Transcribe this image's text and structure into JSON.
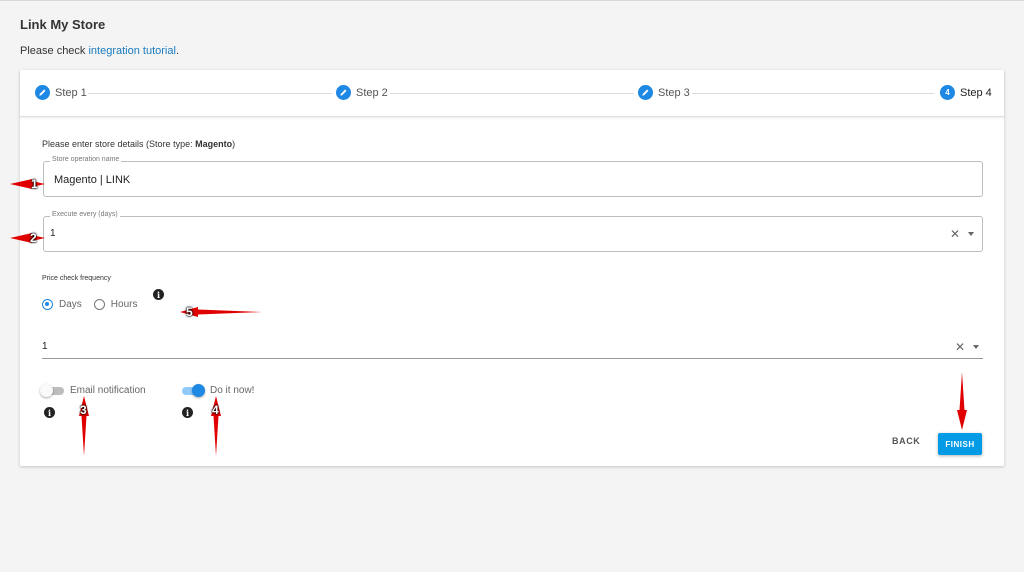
{
  "page": {
    "title": "Link My Store",
    "subtitle_prefix": "Please check ",
    "subtitle_link": "integration tutorial",
    "subtitle_suffix": "."
  },
  "stepper": {
    "steps": [
      {
        "label": "Step 1",
        "icon": "pencil-icon"
      },
      {
        "label": "Step 2",
        "icon": "pencil-icon"
      },
      {
        "label": "Step 3",
        "icon": "pencil-icon"
      },
      {
        "label": "Step 4",
        "number": "4"
      }
    ]
  },
  "form": {
    "heading_prefix": "Please enter store details (Store type: ",
    "store_type": "Magento",
    "heading_suffix": ")",
    "store_name": {
      "label": "Store operation name",
      "value": "Magento | LINK"
    },
    "execute_every": {
      "label": "Execute every (days)",
      "value": "1",
      "clear_icon": "close-icon"
    },
    "price_check": {
      "label": "Price check frequency",
      "options": [
        "Days",
        "Hours"
      ],
      "selected": "Days",
      "info_icon": "info-icon",
      "value": "1"
    },
    "email_notification": {
      "label": "Email notification",
      "enabled": false
    },
    "do_it_now": {
      "label": "Do it now!",
      "enabled": true
    }
  },
  "actions": {
    "back": "BACK",
    "finish": "FINISH"
  },
  "annotations": {
    "markers": [
      "1",
      "2",
      "3",
      "4",
      "5"
    ],
    "arrow_color": "#e00000"
  },
  "colors": {
    "accent": "#1e88e5",
    "finish": "#039be5",
    "link": "#1a7bbf"
  }
}
